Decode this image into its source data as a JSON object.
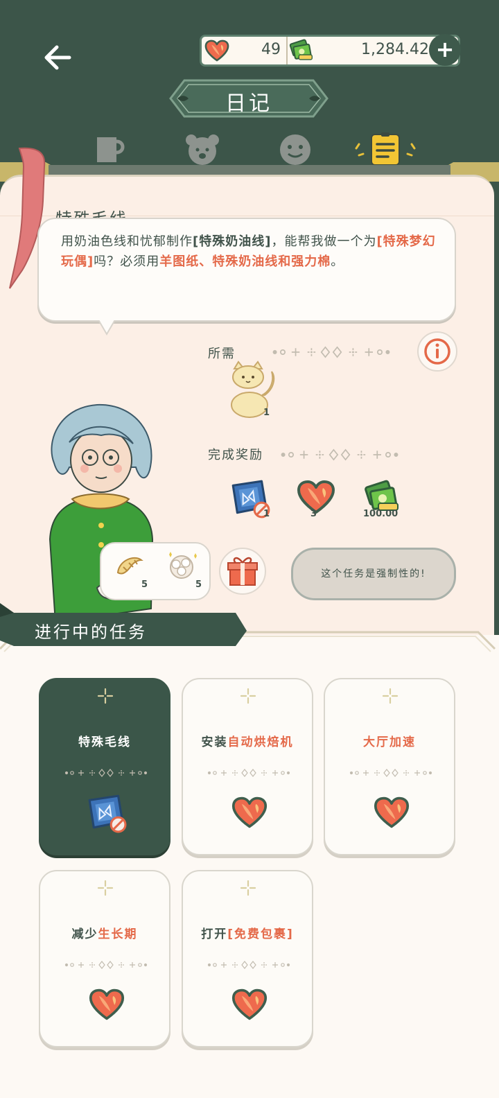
{
  "header": {
    "back_icon": "arrow-left-icon",
    "lives": "49",
    "money": "1,284.42",
    "add_label": "+",
    "title": "日记",
    "tabs": [
      "cup-icon",
      "bear-icon",
      "face-icon",
      "diary-icon"
    ],
    "active_tab": "diary-icon"
  },
  "task": {
    "title": "特殊毛线",
    "dialog_parts": [
      "用奶油色线和忧郁制作",
      "[特殊奶油线]",
      "，能帮我做一个为",
      "[特殊梦幻玩偶]",
      "吗？必须用",
      "羊图纸、特殊奶油线和强力棉",
      "。"
    ],
    "required_label": "所需",
    "required_qty": "1",
    "reward_label": "完成奖励",
    "rewards": [
      {
        "icon": "blueprint-icon",
        "qty": "1"
      },
      {
        "icon": "heart-icon",
        "qty": "3"
      },
      {
        "icon": "money-icon",
        "qty": "100.00"
      }
    ],
    "gift_items": [
      {
        "icon": "croissant-icon",
        "qty": "5"
      },
      {
        "icon": "cotton-icon",
        "qty": "5"
      }
    ],
    "mandatory_text": "这个任务是强制性的!"
  },
  "in_progress": {
    "title": "进行中的任务",
    "cards": [
      {
        "title": "特殊毛线",
        "active": true,
        "icon": "blueprint-icon"
      },
      {
        "title_a": "安装",
        "title_b": "自动烘焙机",
        "active": false,
        "icon": "heart-icon"
      },
      {
        "title": "大厅加速",
        "active": false,
        "icon": "heart-icon"
      },
      {
        "title_a": "减少",
        "title_b": "生长期",
        "active": false,
        "icon": "heart-icon"
      },
      {
        "title_a": "打开",
        "title_b": "[免费包裹]",
        "active": false,
        "icon": "heart-icon"
      }
    ]
  },
  "colors": {
    "background": "#3c5549",
    "panel": "#fcefe6",
    "accent": "#e46949",
    "text": "#41534b"
  }
}
